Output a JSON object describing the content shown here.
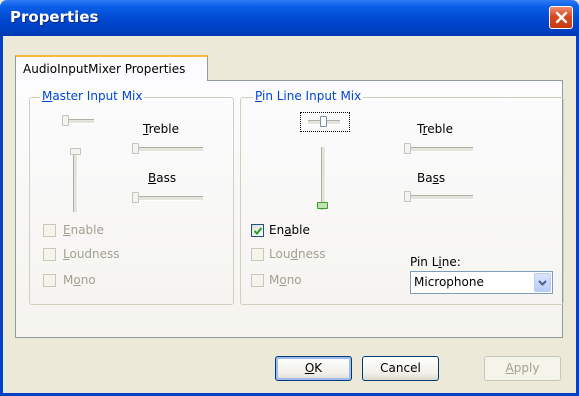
{
  "window": {
    "title": "Properties"
  },
  "tabs": [
    {
      "label": "AudioInputMixer Properties",
      "selected": true
    }
  ],
  "master": {
    "legend": "Master Input Mix",
    "treble_label": "Treble",
    "bass_label": "Bass",
    "enable_label": "Enable",
    "loudness_label": "Loudness",
    "mono_label": "Mono",
    "enabled": false
  },
  "pin": {
    "legend": "Pin Line Input Mix",
    "treble_label": "Treble",
    "bass_label": "Bass",
    "enable_label": "Enable",
    "enable_checked": true,
    "loudness_label": "Loudness",
    "mono_label": "Mono",
    "pin_line_label": "Pin Line:",
    "pin_line_value": "Microphone"
  },
  "buttons": {
    "ok": "OK",
    "cancel": "Cancel",
    "apply": "Apply"
  },
  "icons": {
    "close": "close-icon",
    "checkmark": "checkmark-icon",
    "dropdown": "chevron-down-icon"
  },
  "colors": {
    "titlebar": "#0047cf",
    "accent": "#0046d5",
    "tab_highlight": "#f8b83c",
    "check_green": "#21a121",
    "close_red": "#d8481f"
  }
}
